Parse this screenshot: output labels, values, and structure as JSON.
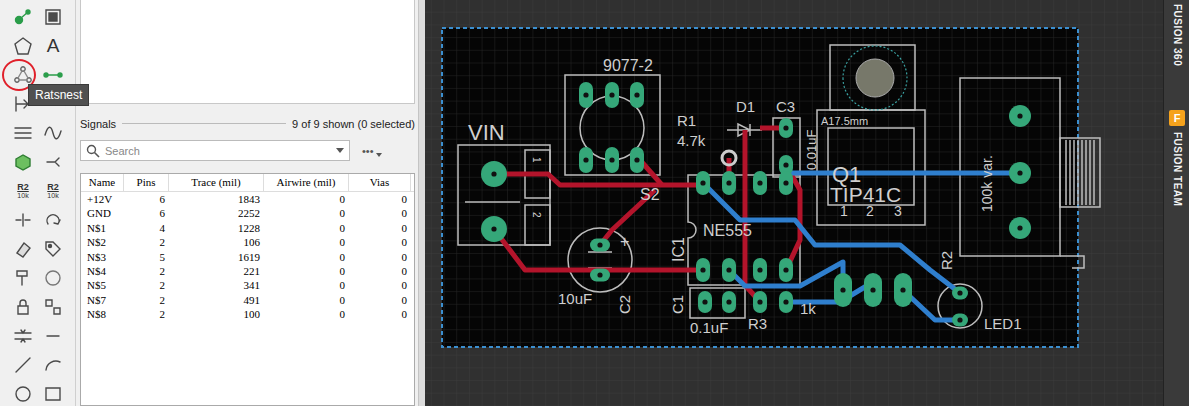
{
  "toolbar": {
    "tooltip": "Ratsnest",
    "buttons": [
      {
        "kind": "glyph",
        "circled": false
      },
      {
        "kind": "glyph",
        "circled": false
      },
      {
        "kind": "glyph",
        "circled": false
      },
      {
        "kind": "text",
        "label": "A",
        "circled": false
      },
      {
        "kind": "glyph",
        "circled": true
      },
      {
        "kind": "glyph",
        "circled": false
      },
      {
        "kind": "glyph",
        "circled": false
      },
      {
        "kind": "glyph",
        "circled": false
      },
      {
        "kind": "glyph",
        "circled": false
      },
      {
        "kind": "glyph",
        "circled": false
      },
      {
        "kind": "glyph",
        "circled": false
      },
      {
        "kind": "glyph",
        "circled": false
      },
      {
        "kind": "part",
        "label": "R2",
        "value": "10k",
        "circled": false
      },
      {
        "kind": "part",
        "label": "R2",
        "value": "10k",
        "circled": false
      },
      {
        "kind": "glyph",
        "circled": false
      },
      {
        "kind": "glyph",
        "circled": false
      },
      {
        "kind": "glyph",
        "circled": false
      },
      {
        "kind": "glyph",
        "circled": false
      },
      {
        "kind": "glyph",
        "circled": false
      },
      {
        "kind": "glyph",
        "circled": false
      },
      {
        "kind": "glyph",
        "circled": false
      },
      {
        "kind": "glyph",
        "circled": false
      },
      {
        "kind": "glyph",
        "circled": false
      },
      {
        "kind": "glyph",
        "circled": false
      },
      {
        "kind": "glyph",
        "circled": false
      },
      {
        "kind": "glyph",
        "circled": false
      },
      {
        "kind": "glyph",
        "circled": false
      },
      {
        "kind": "glyph",
        "circled": false
      }
    ]
  },
  "signals": {
    "title": "Signals",
    "count": "9 of 9 shown (0 selected)",
    "search": {
      "placeholder": "Search"
    },
    "more": "•••",
    "columns": [
      "Name",
      "Pins",
      "Trace (mil)",
      "Airwire (mil)",
      "Vias"
    ],
    "rows": [
      [
        "+12V",
        "6",
        "1843",
        "0",
        "0"
      ],
      [
        "GND",
        "6",
        "2252",
        "0",
        "0"
      ],
      [
        "N$1",
        "4",
        "1228",
        "0",
        "0"
      ],
      [
        "N$2",
        "2",
        "106",
        "0",
        "0"
      ],
      [
        "N$3",
        "5",
        "1619",
        "0",
        "0"
      ],
      [
        "N$4",
        "2",
        "221",
        "0",
        "0"
      ],
      [
        "N$5",
        "2",
        "341",
        "0",
        "0"
      ],
      [
        "N$7",
        "2",
        "491",
        "0",
        "0"
      ],
      [
        "N$8",
        "2",
        "100",
        "0",
        "0"
      ]
    ]
  },
  "pcb": {
    "labels": [
      "VIN",
      "1",
      "2",
      "9077-2",
      "S2",
      "R1",
      "4.7k",
      "D1",
      "C3",
      "0.01uF",
      "Q1",
      "TIP41C",
      "A17.5mm",
      "1",
      "2",
      "3",
      "100k var.",
      "NE555",
      "IC1",
      "10uF",
      "C2",
      "C1",
      "0.1uF",
      "R3",
      "1k",
      "R2",
      "LED1",
      "+"
    ]
  },
  "side_strip": {
    "items": [
      {
        "label": "FUSION 360"
      },
      {
        "label": "FUSION TEAM",
        "badge": "F"
      }
    ]
  }
}
